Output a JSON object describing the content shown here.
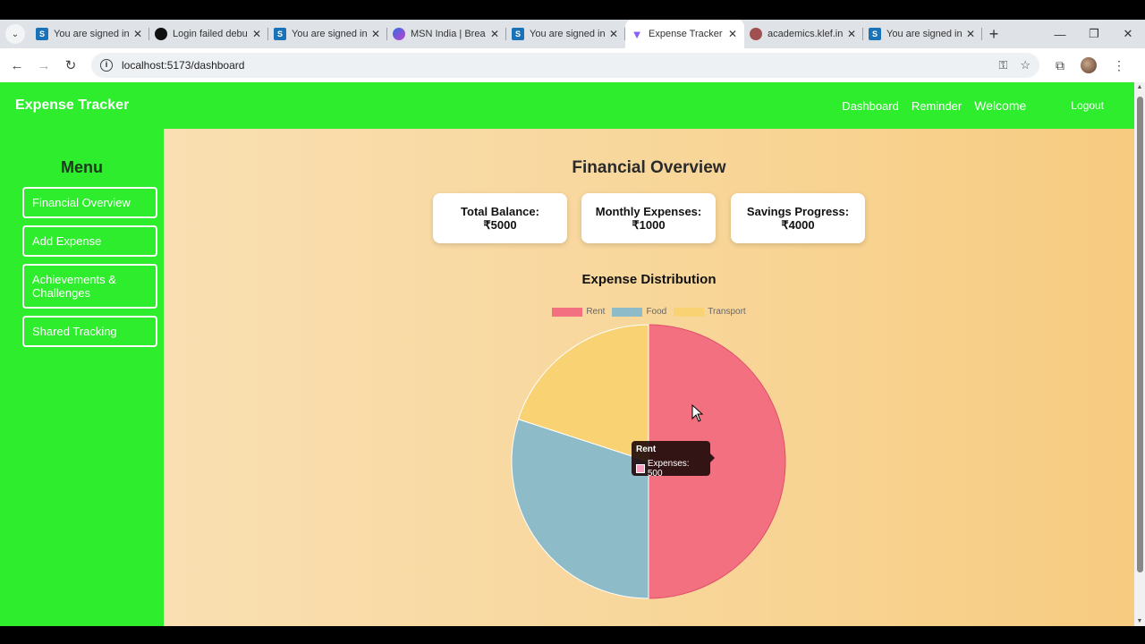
{
  "browser": {
    "tabs": [
      {
        "title": "You are signed in",
        "favicon": "S",
        "type": "s"
      },
      {
        "title": "Login failed debu",
        "favicon": "",
        "type": "gh"
      },
      {
        "title": "You are signed in",
        "favicon": "S",
        "type": "s"
      },
      {
        "title": "MSN India | Brea",
        "favicon": "",
        "type": "msn"
      },
      {
        "title": "You are signed in",
        "favicon": "S",
        "type": "s"
      },
      {
        "title": "Expense Tracker",
        "favicon": "▼",
        "type": "v",
        "active": true
      },
      {
        "title": "academics.klef.in",
        "favicon": "",
        "type": "acad"
      },
      {
        "title": "You are signed in",
        "favicon": "S",
        "type": "s"
      }
    ],
    "url": "localhost:5173/dashboard"
  },
  "header": {
    "brand": "Expense Tracker",
    "nav": [
      "Dashboard",
      "Reminder"
    ],
    "welcome": "Welcome",
    "logout": "Logout"
  },
  "sidebar": {
    "title": "Menu",
    "items": [
      {
        "label": "Financial Overview"
      },
      {
        "label": "Add Expense"
      },
      {
        "label": "Achievements & Challenges"
      },
      {
        "label": "Shared Tracking"
      }
    ]
  },
  "main": {
    "title": "Financial Overview",
    "cards": [
      {
        "label": "Total Balance:",
        "value": "₹5000"
      },
      {
        "label": "Monthly Expenses:",
        "value": "₹1000"
      },
      {
        "label": "Savings Progress:",
        "value": "₹4000"
      }
    ]
  },
  "chart_data": {
    "type": "pie",
    "title": "Expense Distribution",
    "categories": [
      "Rent",
      "Food",
      "Transport"
    ],
    "series": [
      {
        "name": "Expenses",
        "values": [
          500,
          300,
          200
        ]
      }
    ],
    "colors": [
      "#f2707f",
      "#8ebbc8",
      "#f8d273"
    ],
    "legend": "top"
  },
  "tooltip": {
    "title": "Rent",
    "text": "Expenses: 500"
  },
  "colors": {
    "header": "#2ded2d",
    "accent": "#f7cb80"
  }
}
